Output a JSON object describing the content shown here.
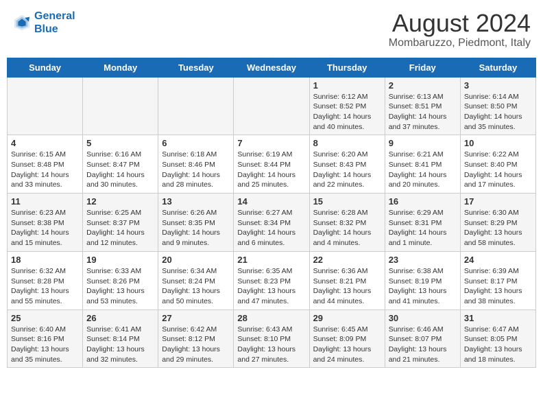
{
  "header": {
    "logo_line1": "General",
    "logo_line2": "Blue",
    "title": "August 2024",
    "subtitle": "Mombaruzzo, Piedmont, Italy"
  },
  "calendar": {
    "weekdays": [
      "Sunday",
      "Monday",
      "Tuesday",
      "Wednesday",
      "Thursday",
      "Friday",
      "Saturday"
    ],
    "weeks": [
      [
        {
          "day": "",
          "info": ""
        },
        {
          "day": "",
          "info": ""
        },
        {
          "day": "",
          "info": ""
        },
        {
          "day": "",
          "info": ""
        },
        {
          "day": "1",
          "info": "Sunrise: 6:12 AM\nSunset: 8:52 PM\nDaylight: 14 hours\nand 40 minutes."
        },
        {
          "day": "2",
          "info": "Sunrise: 6:13 AM\nSunset: 8:51 PM\nDaylight: 14 hours\nand 37 minutes."
        },
        {
          "day": "3",
          "info": "Sunrise: 6:14 AM\nSunset: 8:50 PM\nDaylight: 14 hours\nand 35 minutes."
        }
      ],
      [
        {
          "day": "4",
          "info": "Sunrise: 6:15 AM\nSunset: 8:48 PM\nDaylight: 14 hours\nand 33 minutes."
        },
        {
          "day": "5",
          "info": "Sunrise: 6:16 AM\nSunset: 8:47 PM\nDaylight: 14 hours\nand 30 minutes."
        },
        {
          "day": "6",
          "info": "Sunrise: 6:18 AM\nSunset: 8:46 PM\nDaylight: 14 hours\nand 28 minutes."
        },
        {
          "day": "7",
          "info": "Sunrise: 6:19 AM\nSunset: 8:44 PM\nDaylight: 14 hours\nand 25 minutes."
        },
        {
          "day": "8",
          "info": "Sunrise: 6:20 AM\nSunset: 8:43 PM\nDaylight: 14 hours\nand 22 minutes."
        },
        {
          "day": "9",
          "info": "Sunrise: 6:21 AM\nSunset: 8:41 PM\nDaylight: 14 hours\nand 20 minutes."
        },
        {
          "day": "10",
          "info": "Sunrise: 6:22 AM\nSunset: 8:40 PM\nDaylight: 14 hours\nand 17 minutes."
        }
      ],
      [
        {
          "day": "11",
          "info": "Sunrise: 6:23 AM\nSunset: 8:38 PM\nDaylight: 14 hours\nand 15 minutes."
        },
        {
          "day": "12",
          "info": "Sunrise: 6:25 AM\nSunset: 8:37 PM\nDaylight: 14 hours\nand 12 minutes."
        },
        {
          "day": "13",
          "info": "Sunrise: 6:26 AM\nSunset: 8:35 PM\nDaylight: 14 hours\nand 9 minutes."
        },
        {
          "day": "14",
          "info": "Sunrise: 6:27 AM\nSunset: 8:34 PM\nDaylight: 14 hours\nand 6 minutes."
        },
        {
          "day": "15",
          "info": "Sunrise: 6:28 AM\nSunset: 8:32 PM\nDaylight: 14 hours\nand 4 minutes."
        },
        {
          "day": "16",
          "info": "Sunrise: 6:29 AM\nSunset: 8:31 PM\nDaylight: 14 hours\nand 1 minute."
        },
        {
          "day": "17",
          "info": "Sunrise: 6:30 AM\nSunset: 8:29 PM\nDaylight: 13 hours\nand 58 minutes."
        }
      ],
      [
        {
          "day": "18",
          "info": "Sunrise: 6:32 AM\nSunset: 8:28 PM\nDaylight: 13 hours\nand 55 minutes."
        },
        {
          "day": "19",
          "info": "Sunrise: 6:33 AM\nSunset: 8:26 PM\nDaylight: 13 hours\nand 53 minutes."
        },
        {
          "day": "20",
          "info": "Sunrise: 6:34 AM\nSunset: 8:24 PM\nDaylight: 13 hours\nand 50 minutes."
        },
        {
          "day": "21",
          "info": "Sunrise: 6:35 AM\nSunset: 8:23 PM\nDaylight: 13 hours\nand 47 minutes."
        },
        {
          "day": "22",
          "info": "Sunrise: 6:36 AM\nSunset: 8:21 PM\nDaylight: 13 hours\nand 44 minutes."
        },
        {
          "day": "23",
          "info": "Sunrise: 6:38 AM\nSunset: 8:19 PM\nDaylight: 13 hours\nand 41 minutes."
        },
        {
          "day": "24",
          "info": "Sunrise: 6:39 AM\nSunset: 8:17 PM\nDaylight: 13 hours\nand 38 minutes."
        }
      ],
      [
        {
          "day": "25",
          "info": "Sunrise: 6:40 AM\nSunset: 8:16 PM\nDaylight: 13 hours\nand 35 minutes."
        },
        {
          "day": "26",
          "info": "Sunrise: 6:41 AM\nSunset: 8:14 PM\nDaylight: 13 hours\nand 32 minutes."
        },
        {
          "day": "27",
          "info": "Sunrise: 6:42 AM\nSunset: 8:12 PM\nDaylight: 13 hours\nand 29 minutes."
        },
        {
          "day": "28",
          "info": "Sunrise: 6:43 AM\nSunset: 8:10 PM\nDaylight: 13 hours\nand 27 minutes."
        },
        {
          "day": "29",
          "info": "Sunrise: 6:45 AM\nSunset: 8:09 PM\nDaylight: 13 hours\nand 24 minutes."
        },
        {
          "day": "30",
          "info": "Sunrise: 6:46 AM\nSunset: 8:07 PM\nDaylight: 13 hours\nand 21 minutes."
        },
        {
          "day": "31",
          "info": "Sunrise: 6:47 AM\nSunset: 8:05 PM\nDaylight: 13 hours\nand 18 minutes."
        }
      ]
    ]
  }
}
